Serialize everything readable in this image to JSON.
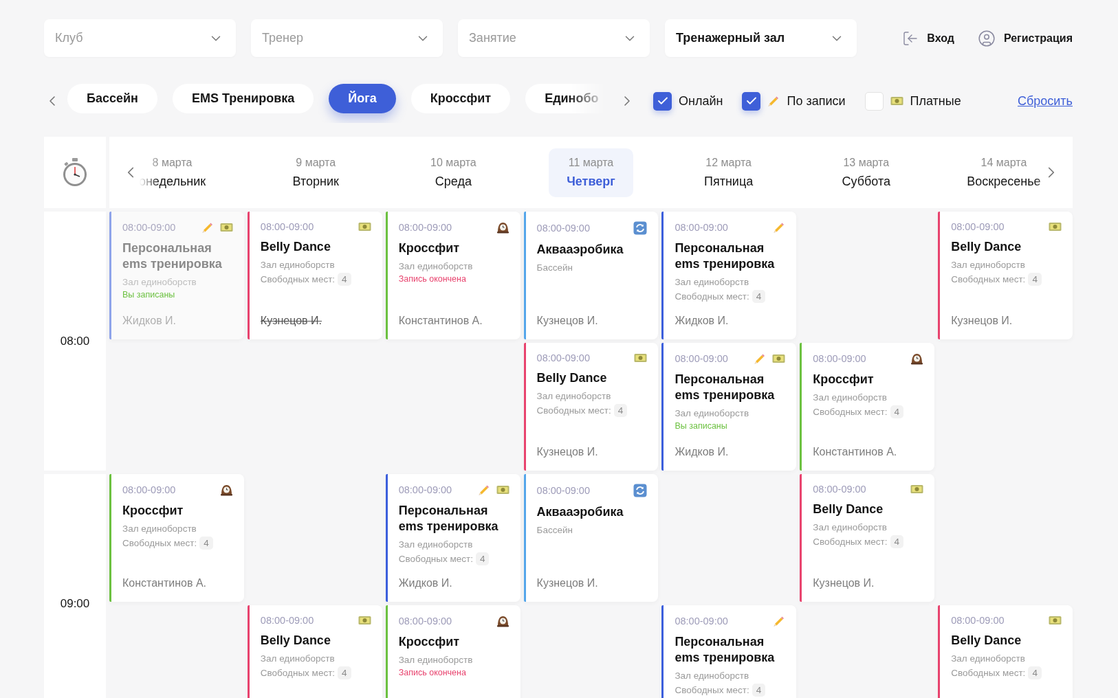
{
  "selects": [
    {
      "placeholder": "Клуб"
    },
    {
      "placeholder": "Тренер"
    },
    {
      "placeholder": "Занятие"
    },
    {
      "value": "Тренажерный зал"
    }
  ],
  "auth": [
    {
      "kind": "login",
      "label": "Вход"
    },
    {
      "kind": "register",
      "label": "Регистрация"
    }
  ],
  "chips": [
    {
      "label": "Бассейн",
      "selected": false
    },
    {
      "label": "EMS Тренировка",
      "selected": false
    },
    {
      "label": "Йога",
      "selected": true
    },
    {
      "label": "Кроссфит",
      "selected": false
    },
    {
      "label": "Единобо",
      "selected": false
    }
  ],
  "filters": [
    {
      "label": "Онлайн",
      "checked": true,
      "kind": "plain"
    },
    {
      "label": "По записи",
      "checked": true,
      "kind": "signup"
    },
    {
      "label": "Платные",
      "checked": false,
      "kind": "paid"
    }
  ],
  "reset": "Сбросить",
  "days": [
    {
      "date": "8 марта",
      "weekday": "онедельник",
      "selected": false
    },
    {
      "date": "9 марта",
      "weekday": "Вторник",
      "selected": false
    },
    {
      "date": "10 марта",
      "weekday": "Среда",
      "selected": false
    },
    {
      "date": "11 марта",
      "weekday": "Четверг",
      "selected": true
    },
    {
      "date": "12 марта",
      "weekday": "Пятница",
      "selected": false
    },
    {
      "date": "13 марта",
      "weekday": "Суббота",
      "selected": false
    },
    {
      "date": "14 марта",
      "weekday": "Воскресенье",
      "selected": false
    }
  ],
  "hours": [
    {
      "time": "08:00",
      "slots": [
        {
          "cells": [
            {
              "kind": "class",
              "faded": true,
              "color": "#8fa4ea",
              "time": "08:00-09:00",
              "marks": [
                {
                  "kind": "signup"
                },
                {
                  "kind": "paid"
                }
              ],
              "title": "Персональная ems тренировка",
              "place": "Зал единоборств",
              "status": {
                "kind": "enrolled",
                "text": "Вы записаны"
              },
              "trainer": "Жидков И.",
              "struck": false
            },
            {
              "kind": "class",
              "faded": false,
              "color": "#e8436e",
              "time": "08:00-09:00",
              "marks": [
                {
                  "kind": "paid"
                }
              ],
              "title": "Belly Dance",
              "place": "Зал единоборств",
              "seats_label": "Свободных мест:",
              "seats": "4",
              "trainer": "Кузнецов И.",
              "struck": true
            },
            {
              "kind": "class",
              "faded": false,
              "color": "#6cc140",
              "time": "08:00-09:00",
              "marks": [
                {
                  "kind": "timed"
                }
              ],
              "title": "Кроссфит",
              "place": "Зал единоборств",
              "status": {
                "kind": "closed",
                "text": "Запись окончена"
              },
              "trainer": "Константинов А.",
              "struck": false
            },
            {
              "kind": "class",
              "faded": false,
              "color": "#54a6ea",
              "time": "08:00-09:00",
              "marks": [
                {
                  "kind": "recurring"
                }
              ],
              "title": "Аквааэробика",
              "place": "Бассейн",
              "trainer": "Кузнецов И.",
              "struck": false
            },
            {
              "kind": "class",
              "faded": false,
              "color": "#3c5fdc",
              "time": "08:00-09:00",
              "marks": [
                {
                  "kind": "signup"
                }
              ],
              "title": "Персональная ems тренировка",
              "place": "Зал единоборств",
              "seats_label": "Свободных мест:",
              "seats": "4",
              "trainer": "Жидков И.",
              "struck": false
            },
            {
              "kind": "empty"
            },
            {
              "kind": "class",
              "faded": false,
              "color": "#e8436e",
              "time": "08:00-09:00",
              "marks": [
                {
                  "kind": "paid"
                }
              ],
              "title": "Belly Dance",
              "place": "Зал единоборств",
              "seats_label": "Свободных мест:",
              "seats": "4",
              "trainer": "Кузнецов И.",
              "struck": false
            }
          ]
        },
        {
          "cells": [
            {
              "kind": "empty"
            },
            {
              "kind": "empty"
            },
            {
              "kind": "empty"
            },
            {
              "kind": "class",
              "faded": false,
              "color": "#e8436e",
              "time": "08:00-09:00",
              "marks": [
                {
                  "kind": "paid"
                }
              ],
              "title": "Belly Dance",
              "place": "Зал единоборств",
              "seats_label": "Свободных мест:",
              "seats": "4",
              "trainer": "Кузнецов И.",
              "struck": false
            },
            {
              "kind": "class",
              "faded": false,
              "color": "#3c5fdc",
              "time": "08:00-09:00",
              "marks": [
                {
                  "kind": "signup"
                },
                {
                  "kind": "paid"
                }
              ],
              "title": "Персональная ems тренировка",
              "place": "Зал единоборств",
              "status": {
                "kind": "enrolled",
                "text": "Вы записаны"
              },
              "trainer": "Жидков И.",
              "struck": false
            },
            {
              "kind": "class",
              "faded": false,
              "color": "#6cc140",
              "time": "08:00-09:00",
              "marks": [
                {
                  "kind": "timed"
                }
              ],
              "title": "Кроссфит",
              "place": "Зал единоборств",
              "seats_label": "Свободных мест:",
              "seats": "4",
              "trainer": "Константинов А.",
              "struck": false
            },
            {
              "kind": "empty"
            }
          ]
        }
      ]
    },
    {
      "time": "09:00",
      "slots": [
        {
          "cells": [
            {
              "kind": "class",
              "faded": false,
              "color": "#6cc140",
              "time": "08:00-09:00",
              "marks": [
                {
                  "kind": "timed"
                }
              ],
              "title": "Кроссфит",
              "place": "Зал единоборств",
              "seats_label": "Свободных мест:",
              "seats": "4",
              "trainer": "Константинов А.",
              "struck": false
            },
            {
              "kind": "empty"
            },
            {
              "kind": "class",
              "faded": false,
              "color": "#3c5fdc",
              "time": "08:00-09:00",
              "marks": [
                {
                  "kind": "signup"
                },
                {
                  "kind": "paid"
                }
              ],
              "title": "Персональная ems тренировка",
              "place": "Зал единоборств",
              "seats_label": "Свободных мест:",
              "seats": "4",
              "trainer": "Жидков И.",
              "struck": false
            },
            {
              "kind": "class",
              "faded": false,
              "color": "#54a6ea",
              "time": "08:00-09:00",
              "marks": [
                {
                  "kind": "recurring"
                }
              ],
              "title": "Аквааэробика",
              "place": "Бассейн",
              "trainer": "Кузнецов И.",
              "struck": false
            },
            {
              "kind": "empty"
            },
            {
              "kind": "class",
              "faded": false,
              "color": "#e8436e",
              "time": "08:00-09:00",
              "marks": [
                {
                  "kind": "paid"
                }
              ],
              "title": "Belly Dance",
              "place": "Зал единоборств",
              "seats_label": "Свободных мест:",
              "seats": "4",
              "trainer": "Кузнецов И.",
              "struck": false
            },
            {
              "kind": "empty"
            }
          ]
        },
        {
          "cells": [
            {
              "kind": "empty"
            },
            {
              "kind": "class",
              "faded": false,
              "color": "#e8436e",
              "time": "08:00-09:00",
              "marks": [
                {
                  "kind": "paid"
                }
              ],
              "title": "Belly Dance",
              "place": "Зал единоборств",
              "seats_label": "Свободных мест:",
              "seats": "4"
            },
            {
              "kind": "class",
              "faded": false,
              "color": "#6cc140",
              "time": "08:00-09:00",
              "marks": [
                {
                  "kind": "timed"
                }
              ],
              "title": "Кроссфит",
              "place": "Зал единоборств",
              "status": {
                "kind": "closed",
                "text": "Запись окончена"
              }
            },
            {
              "kind": "empty"
            },
            {
              "kind": "class",
              "faded": false,
              "color": "#3c5fdc",
              "time": "08:00-09:00",
              "marks": [
                {
                  "kind": "signup"
                }
              ],
              "title": "Персональная ems тренировка",
              "place": "Зал единоборств",
              "seats_label": "Свободных мест:",
              "seats": "4"
            },
            {
              "kind": "empty"
            },
            {
              "kind": "class",
              "faded": false,
              "color": "#e8436e",
              "time": "08:00-09:00",
              "marks": [
                {
                  "kind": "paid"
                }
              ],
              "title": "Belly Dance",
              "place": "Зал единоборств",
              "seats_label": "Свободных мест:",
              "seats": "4"
            }
          ]
        }
      ]
    }
  ]
}
